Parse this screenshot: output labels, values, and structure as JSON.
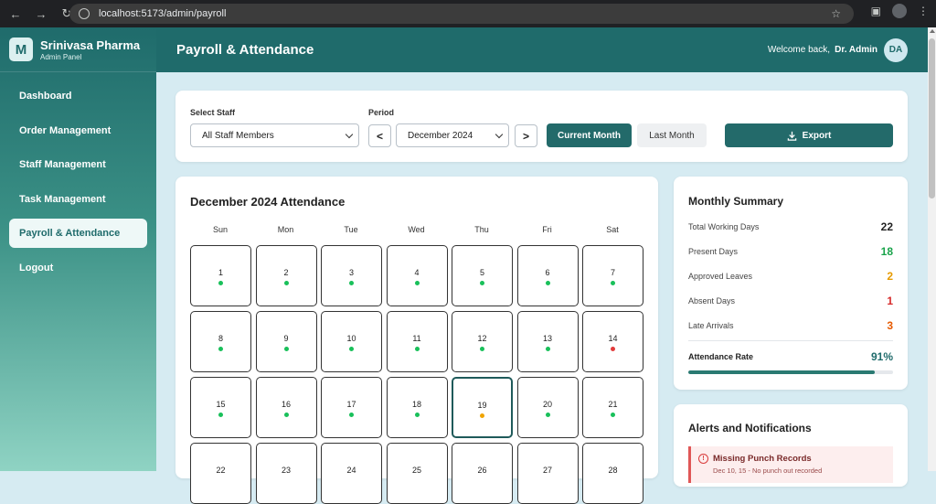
{
  "browser": {
    "url": "localhost:5173/admin/payroll"
  },
  "brand": {
    "logo_letter": "M",
    "name": "Srinivasa Pharma",
    "subtitle": "Admin Panel"
  },
  "sidebar": {
    "items": [
      {
        "label": "Dashboard",
        "active": false
      },
      {
        "label": "Order Management",
        "active": false
      },
      {
        "label": "Staff Management",
        "active": false
      },
      {
        "label": "Task Management",
        "active": false
      },
      {
        "label": "Payroll & Attendance",
        "active": true
      },
      {
        "label": "Logout",
        "active": false
      }
    ]
  },
  "header": {
    "title": "Payroll & Attendance",
    "welcome": "Welcome back,",
    "user_name": "Dr. Admin",
    "avatar_initials": "DA"
  },
  "filters": {
    "staff_label": "Select Staff",
    "staff_value": "All Staff Members",
    "period_label": "Period",
    "period_value": "December 2024",
    "prev_icon": "<",
    "next_icon": ">",
    "current_month_label": "Current Month",
    "last_month_label": "Last Month",
    "export_label": "Export"
  },
  "calendar": {
    "title": "December 2024 Attendance",
    "weekdays": [
      "Sun",
      "Mon",
      "Tue",
      "Wed",
      "Thu",
      "Fri",
      "Sat"
    ],
    "today": 19,
    "days": [
      {
        "day": "1",
        "status": "present"
      },
      {
        "day": "2",
        "status": "present"
      },
      {
        "day": "3",
        "status": "present"
      },
      {
        "day": "4",
        "status": "present"
      },
      {
        "day": "5",
        "status": "present"
      },
      {
        "day": "6",
        "status": "present"
      },
      {
        "day": "7",
        "status": "present"
      },
      {
        "day": "8",
        "status": "present"
      },
      {
        "day": "9",
        "status": "present"
      },
      {
        "day": "10",
        "status": "present"
      },
      {
        "day": "11",
        "status": "present"
      },
      {
        "day": "12",
        "status": "present"
      },
      {
        "day": "13",
        "status": "present"
      },
      {
        "day": "14",
        "status": "absent"
      },
      {
        "day": "15",
        "status": "present"
      },
      {
        "day": "16",
        "status": "present"
      },
      {
        "day": "17",
        "status": "present"
      },
      {
        "day": "18",
        "status": "present"
      },
      {
        "day": "19",
        "status": "leave"
      },
      {
        "day": "20",
        "status": "present"
      },
      {
        "day": "21",
        "status": "present"
      },
      {
        "day": "22",
        "status": ""
      },
      {
        "day": "23",
        "status": ""
      },
      {
        "day": "24",
        "status": ""
      },
      {
        "day": "25",
        "status": ""
      },
      {
        "day": "26",
        "status": ""
      },
      {
        "day": "27",
        "status": ""
      },
      {
        "day": "28",
        "status": ""
      }
    ],
    "status_colors": {
      "present": "#19c05a",
      "absent": "#e23b3b",
      "leave": "#f0a400"
    }
  },
  "summary": {
    "title": "Monthly Summary",
    "rows": [
      {
        "label": "Total Working Days",
        "value": "22",
        "color": "#222222"
      },
      {
        "label": "Present Days",
        "value": "18",
        "color": "#19a34a"
      },
      {
        "label": "Approved Leaves",
        "value": "2",
        "color": "#e69a00"
      },
      {
        "label": "Absent Days",
        "value": "1",
        "color": "#d62828"
      },
      {
        "label": "Late Arrivals",
        "value": "3",
        "color": "#e65a00"
      }
    ],
    "rate_label": "Attendance Rate",
    "rate_value": "91%",
    "rate_fraction": 0.91
  },
  "alerts": {
    "title": "Alerts and Notifications",
    "items": [
      {
        "title": "Missing Punch Records",
        "detail": "Dec 10, 15 - No punch out recorded"
      }
    ]
  },
  "colors": {
    "primary": "#1f6b6b",
    "background": "#d6ebf2"
  }
}
